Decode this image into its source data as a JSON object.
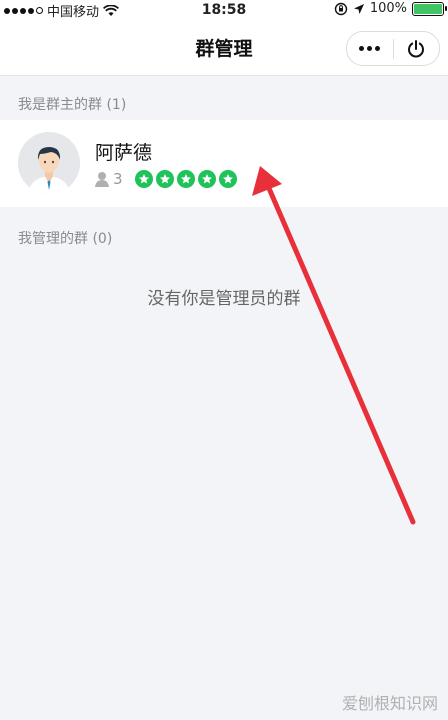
{
  "status_bar": {
    "carrier": "中国移动",
    "time": "18:58",
    "battery": "100%",
    "battery_level": 1.0,
    "signal_bars": 4,
    "icons": [
      "signal-icon",
      "wifi-icon",
      "orientation-lock-icon",
      "location-icon",
      "battery-icon"
    ]
  },
  "header": {
    "title": "群管理",
    "more_icon": "more-dots-icon",
    "close_icon": "power-icon"
  },
  "owned_groups": {
    "label": "我是群主的群 (1)",
    "items": [
      {
        "name": "阿萨德",
        "member_count": "3",
        "star_count": 5,
        "avatar": "user-avatar-icon"
      }
    ]
  },
  "managed_groups": {
    "label": "我管理的群 (0)",
    "empty_text": "没有你是管理员的群"
  },
  "colors": {
    "accent_green": "#20c25a",
    "annotation_red": "#e8303a",
    "background": "#f3f4f8"
  },
  "watermark": "爱刨根知识网"
}
